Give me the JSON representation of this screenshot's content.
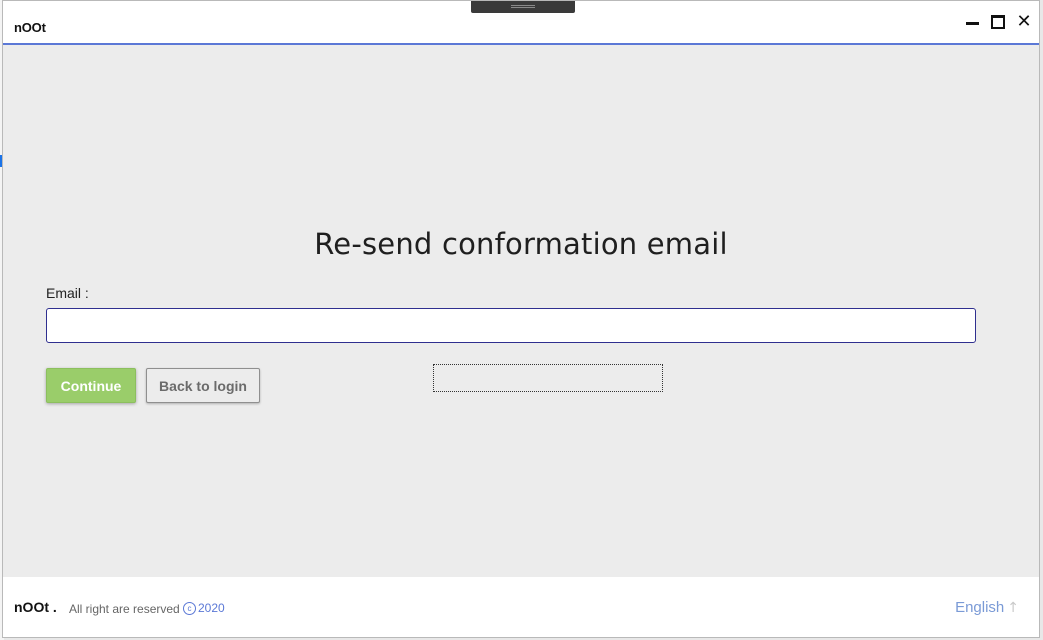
{
  "window": {
    "title": "nOOt"
  },
  "main": {
    "heading": "Re-send conformation email",
    "email_label": "Email :",
    "email_value": "",
    "email_placeholder": "",
    "continue_label": "Continue",
    "back_label": "Back to login"
  },
  "footer": {
    "brand": "nOOt .",
    "rights": "All right are reserved",
    "year": "2020",
    "language": "English"
  },
  "icons": {
    "minimize": "minimize-icon",
    "maximize": "maximize-icon",
    "close": "close-icon",
    "copyright": "copyright-icon",
    "language_arrow": "arrow-up-icon"
  },
  "colors": {
    "accent": "#5b78d6",
    "continue_button": "#9acd6a",
    "background": "#ececec"
  }
}
